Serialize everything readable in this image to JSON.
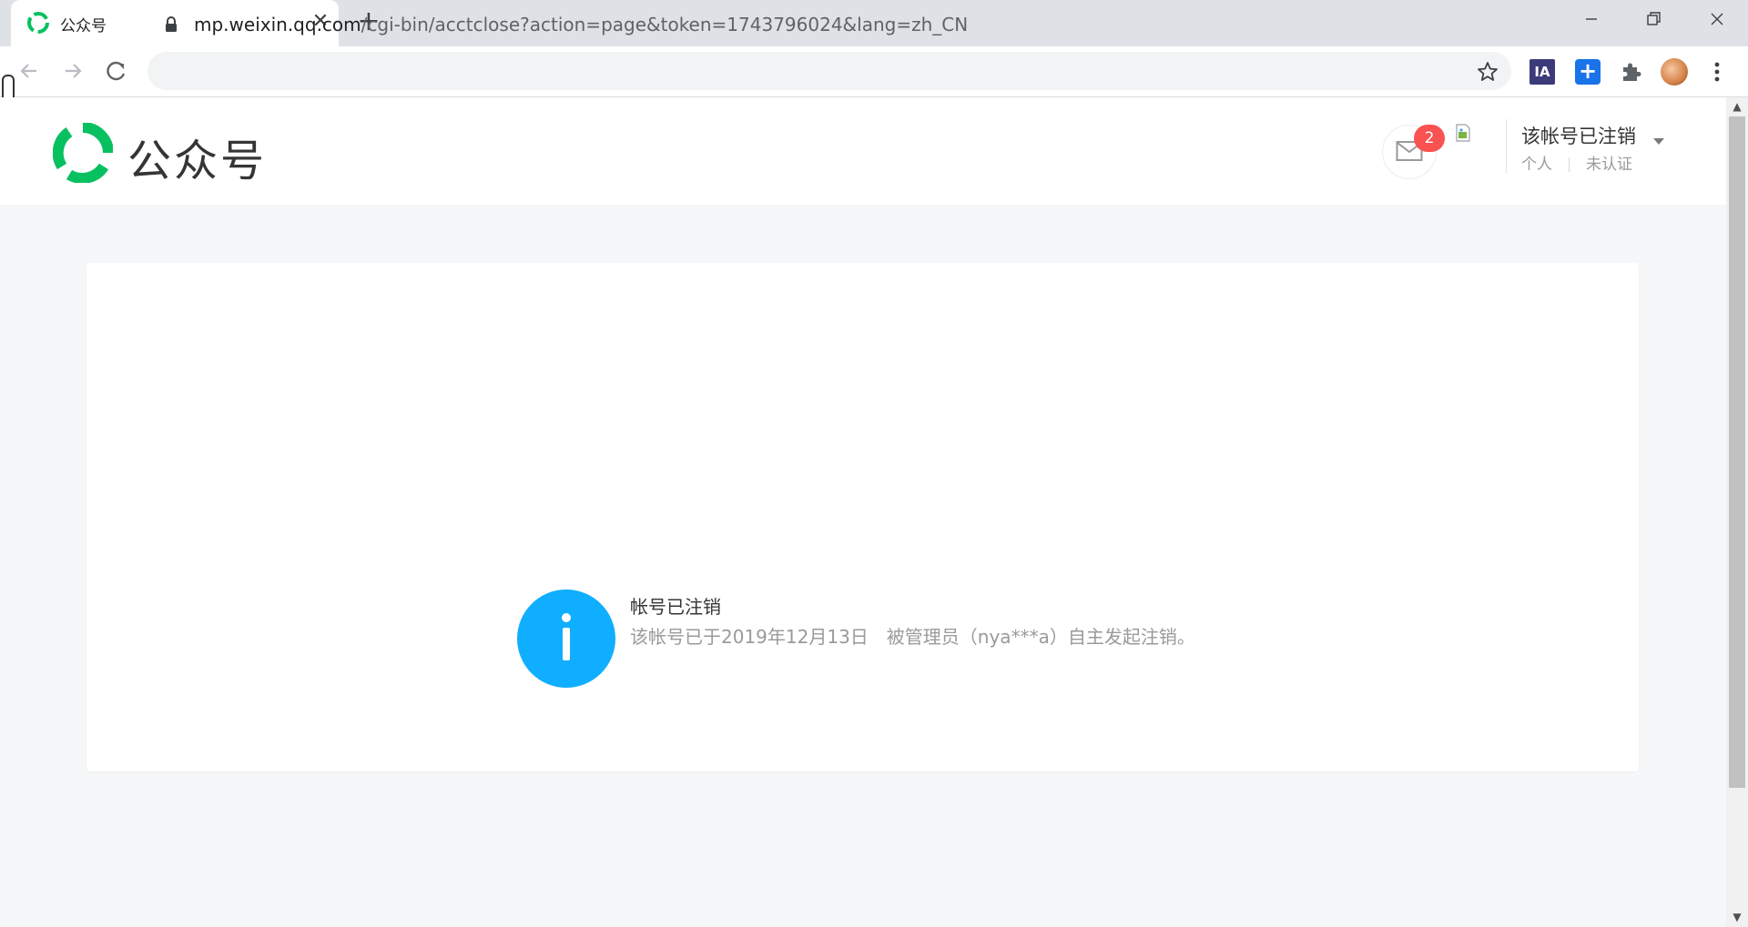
{
  "browser": {
    "tab": {
      "title": "公众号",
      "close_glyph": "✕"
    },
    "new_tab_glyph": "+",
    "url": {
      "host": "mp.weixin.qq.com",
      "path": "/cgi-bin/acctclose?action=page&token=1743796024&lang=zh_CN"
    },
    "extensions": [
      {
        "name": "ia-extension",
        "label": "IA"
      },
      {
        "name": "plus-extension",
        "label": "+"
      },
      {
        "name": "extensions-puzzle",
        "icon": "puzzle-icon"
      },
      {
        "name": "profile-avatar",
        "icon": "avatar-icon"
      }
    ],
    "colors": {
      "tabstrip": "#dee1e6",
      "toolbar": "#ffffff",
      "omnibox": "#f1f3f4"
    }
  },
  "header": {
    "logo_text": "公众号",
    "brand_color": "#07c160",
    "mail": {
      "icon": "mail-icon",
      "badge": "2"
    },
    "account": {
      "name": "该帐号已注销",
      "type": "个人",
      "verification": "未认证"
    }
  },
  "main": {
    "status_icon": "info-icon",
    "status_color": "#10aeff",
    "title": "帐号已注销",
    "description": "该帐号已于2019年12月13日　被管理员（nya***a）自主发起注销。"
  }
}
